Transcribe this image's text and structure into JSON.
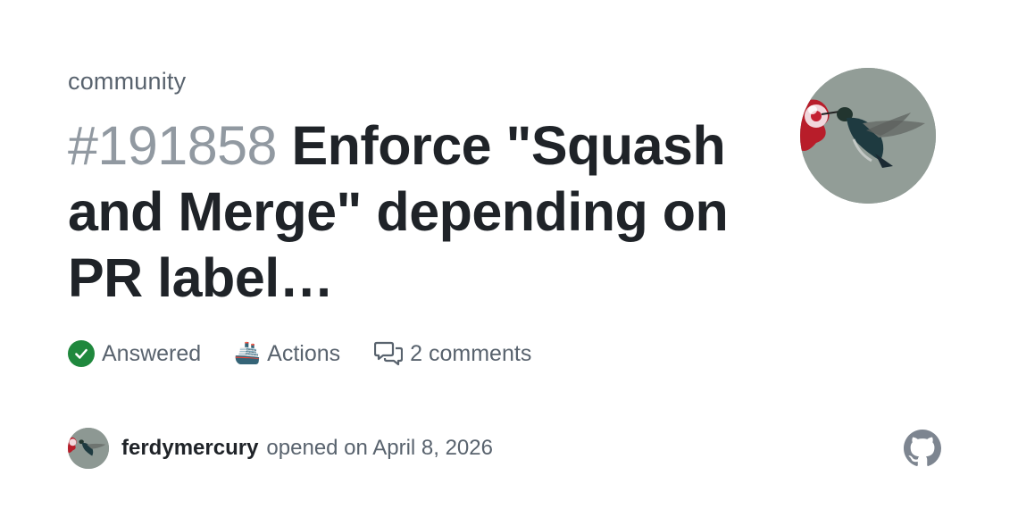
{
  "repository": "community",
  "discussion": {
    "number": "#191858",
    "title": "Enforce \"Squash and Merge\" depending on PR label…"
  },
  "stats": {
    "status": "Answered",
    "category": "Actions",
    "comments": "2 comments"
  },
  "author": {
    "username": "ferdymercury",
    "opened_text": "opened on April 8, 2026"
  },
  "icons": {
    "status": "check-circle-icon",
    "category": "ship-icon",
    "comments": "comment-discussion-icon",
    "brand": "github-mark-icon"
  },
  "colors": {
    "status_green": "#1f883d",
    "title_text": "#1f2328",
    "muted_text": "#59636e",
    "number_text": "#9199a1"
  }
}
